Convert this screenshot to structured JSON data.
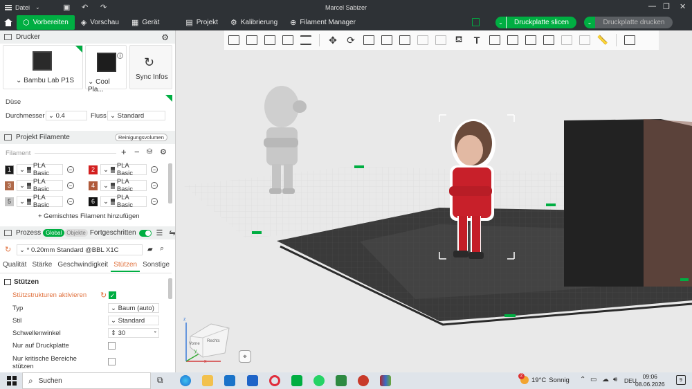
{
  "window": {
    "title": "Marcel Sabizer",
    "menu_label": "Datei"
  },
  "tabs": [
    {
      "label": "Vorbereiten",
      "active": true
    },
    {
      "label": "Vorschau"
    },
    {
      "label": "Gerät"
    },
    {
      "label": "Projekt"
    },
    {
      "label": "Kalibrierung"
    },
    {
      "label": "Filament Manager"
    }
  ],
  "actions": {
    "slice": "Druckplatte slicen",
    "print": "Druckplatte drucken"
  },
  "printer": {
    "section": "Drucker",
    "model": "Bambu Lab P1S",
    "plate": "Cool Pla...",
    "sync": "Sync Infos",
    "nozzle_label": "Düse",
    "diameter_label": "Durchmesser",
    "diameter_value": "0.4",
    "flow_label": "Fluss",
    "flow_value": "Standard"
  },
  "filaments": {
    "section": "Projekt Filamente",
    "purge_label": "Reinigungsvolumen",
    "group_label": "Filament",
    "items": [
      {
        "num": "1",
        "name": "PLA Basic",
        "color": "#1a1a1a"
      },
      {
        "num": "2",
        "name": "PLA Basic",
        "color": "#d31f1f"
      },
      {
        "num": "3",
        "name": "PLA Basic",
        "color": "#b06a4a"
      },
      {
        "num": "4",
        "name": "PLA Basic",
        "color": "#b05a3a"
      },
      {
        "num": "5",
        "name": "PLA Basic",
        "color": "#c8c8c8"
      },
      {
        "num": "6",
        "name": "PLA Basic",
        "color": "#111111"
      }
    ],
    "add_mixed": "+ Gemischtes Filament hinzufügen"
  },
  "process": {
    "section": "Prozess",
    "global": "Global",
    "objects": "Objekte",
    "advanced": "Fortgeschritten",
    "profile": "* 0.20mm Standard @BBL X1C",
    "tabs": [
      "Qualität",
      "Stärke",
      "Geschwindigkeit",
      "Stützen",
      "Sonstige"
    ],
    "active_tab": "Stützen",
    "group_title": "Stützen",
    "options": [
      {
        "label": "Stützstrukturen aktivieren",
        "checked": true
      },
      {
        "label": "Typ",
        "value": "Baum (auto)"
      },
      {
        "label": "Stil",
        "value": "Standard"
      },
      {
        "label": "Schwellenwinkel",
        "value": "30",
        "unit": "°"
      },
      {
        "label": "Nur auf Druckplatte",
        "checked": false
      },
      {
        "label": "Nur kritische Bereiche stützen",
        "checked": false
      }
    ]
  },
  "viewport": {
    "cube_front": "Vorne",
    "cube_right": "Rechts",
    "axis_z": "z",
    "axis_x": "x",
    "axis_y": "y"
  },
  "taskbar": {
    "search": "Suchen",
    "weather_temp": "19°C",
    "weather_text": "Sonnig",
    "language": "DEU",
    "time": "09:06",
    "date": "08.06.2026",
    "notifications": "9",
    "weather_badge": "2"
  }
}
